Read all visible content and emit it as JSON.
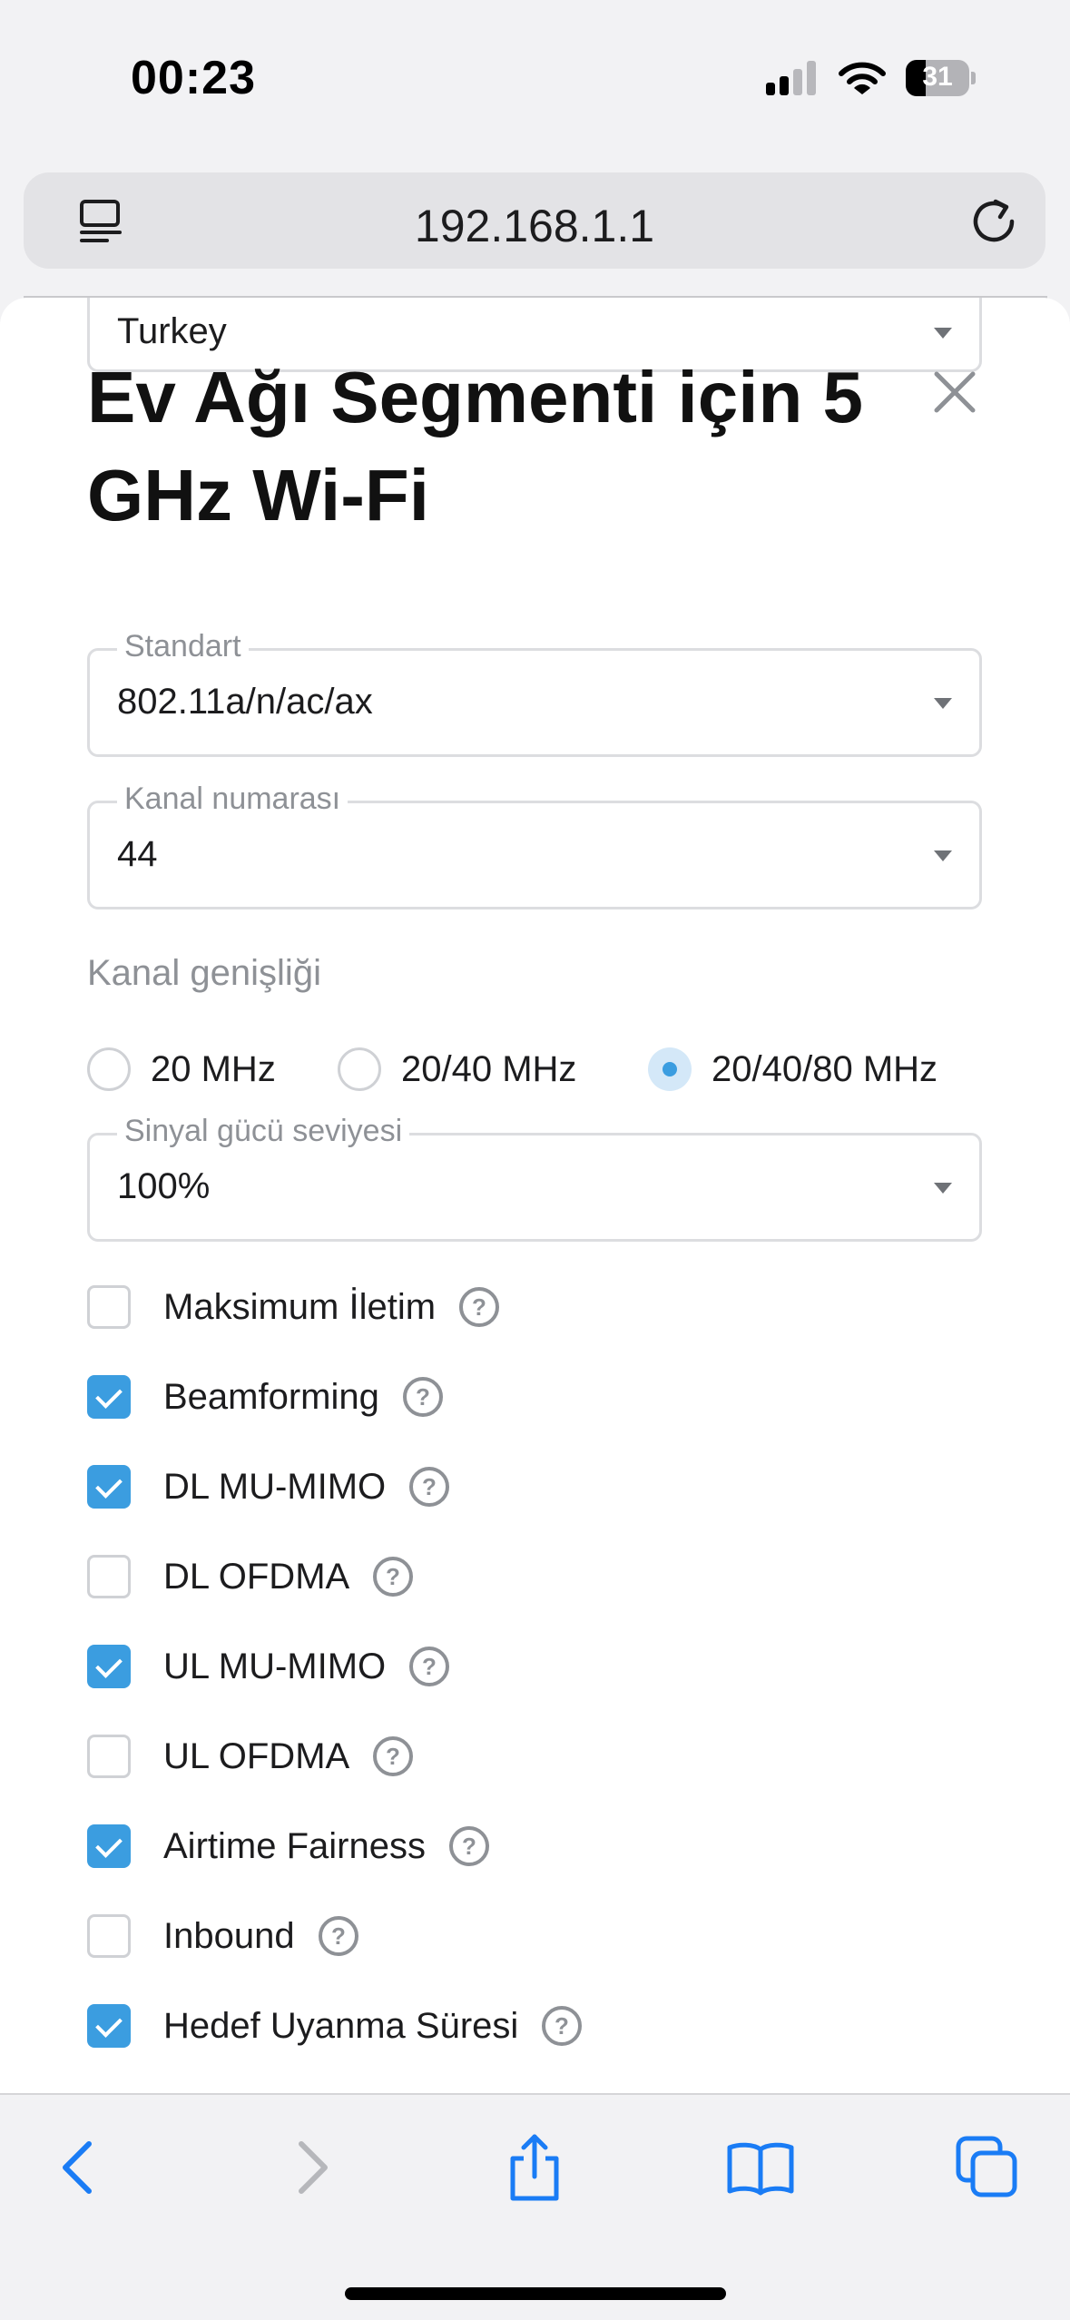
{
  "status_bar": {
    "time": "00:23",
    "battery_level": "31",
    "icons": [
      "signal-icon",
      "wifi-icon",
      "battery-icon"
    ]
  },
  "browser": {
    "url": "192.168.1.1",
    "icons": [
      "reader-icon",
      "reload-icon"
    ]
  },
  "sheet": {
    "title": "Ev Ağı Segmenti için 5 GHz Wi-Fi",
    "fields": {
      "country": {
        "value": "Turkey"
      },
      "standard": {
        "label": "Standart",
        "value": "802.11a/n/ac/ax"
      },
      "channel": {
        "label": "Kanal numarası",
        "value": "44"
      },
      "signal": {
        "label": "Sinyal gücü seviyesi",
        "value": "100%"
      }
    },
    "channel_width": {
      "label": "Kanal genişliği",
      "options": [
        {
          "label": "20 MHz",
          "selected": false
        },
        {
          "label": "20/40 MHz",
          "selected": false
        },
        {
          "label": "20/40/80 MHz",
          "selected": true
        }
      ]
    },
    "checkboxes": [
      {
        "label": "Maksimum İletim",
        "checked": false
      },
      {
        "label": "Beamforming",
        "checked": true
      },
      {
        "label": "DL MU-MIMO",
        "checked": true
      },
      {
        "label": "DL OFDMA",
        "checked": false
      },
      {
        "label": "UL MU-MIMO",
        "checked": true
      },
      {
        "label": "UL OFDMA",
        "checked": false
      },
      {
        "label": "Airtime Fairness",
        "checked": true
      },
      {
        "label": "Inbound",
        "checked": false
      },
      {
        "label": "Hedef Uyanma Süresi",
        "checked": true
      }
    ]
  },
  "toolbar": {
    "icons": [
      "back-icon",
      "forward-icon",
      "share-icon",
      "bookmarks-icon",
      "tabs-icon"
    ]
  },
  "colors": {
    "accent": "#3b9de0",
    "toolbar_icon": "#1a7cf5"
  }
}
